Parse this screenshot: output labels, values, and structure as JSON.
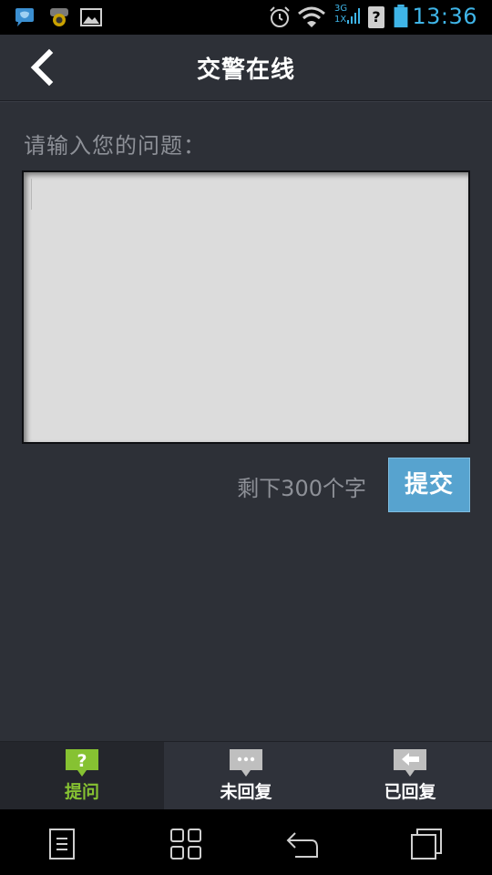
{
  "status_bar": {
    "time": "13:36",
    "network_label_top": "3G",
    "network_label_bottom": "1X",
    "sim_label": "?"
  },
  "header": {
    "title": "交警在线"
  },
  "form": {
    "prompt": "请输入您的问题：",
    "question_value": "",
    "remaining_text": "剩下300个字",
    "submit_label": "提交"
  },
  "tabs": [
    {
      "label": "提问",
      "icon": "question-bubble-icon",
      "active": true
    },
    {
      "label": "未回复",
      "icon": "ellipsis-bubble-icon",
      "active": false
    },
    {
      "label": "已回复",
      "icon": "reply-bubble-icon",
      "active": false
    }
  ],
  "nav": [
    "menu-icon",
    "home-icon",
    "back-icon",
    "recent-apps-icon"
  ],
  "colors": {
    "background": "#2d3037",
    "accent_blue": "#57a3cf",
    "active_tab_green": "#86c232",
    "status_blue": "#3fb5e8"
  }
}
